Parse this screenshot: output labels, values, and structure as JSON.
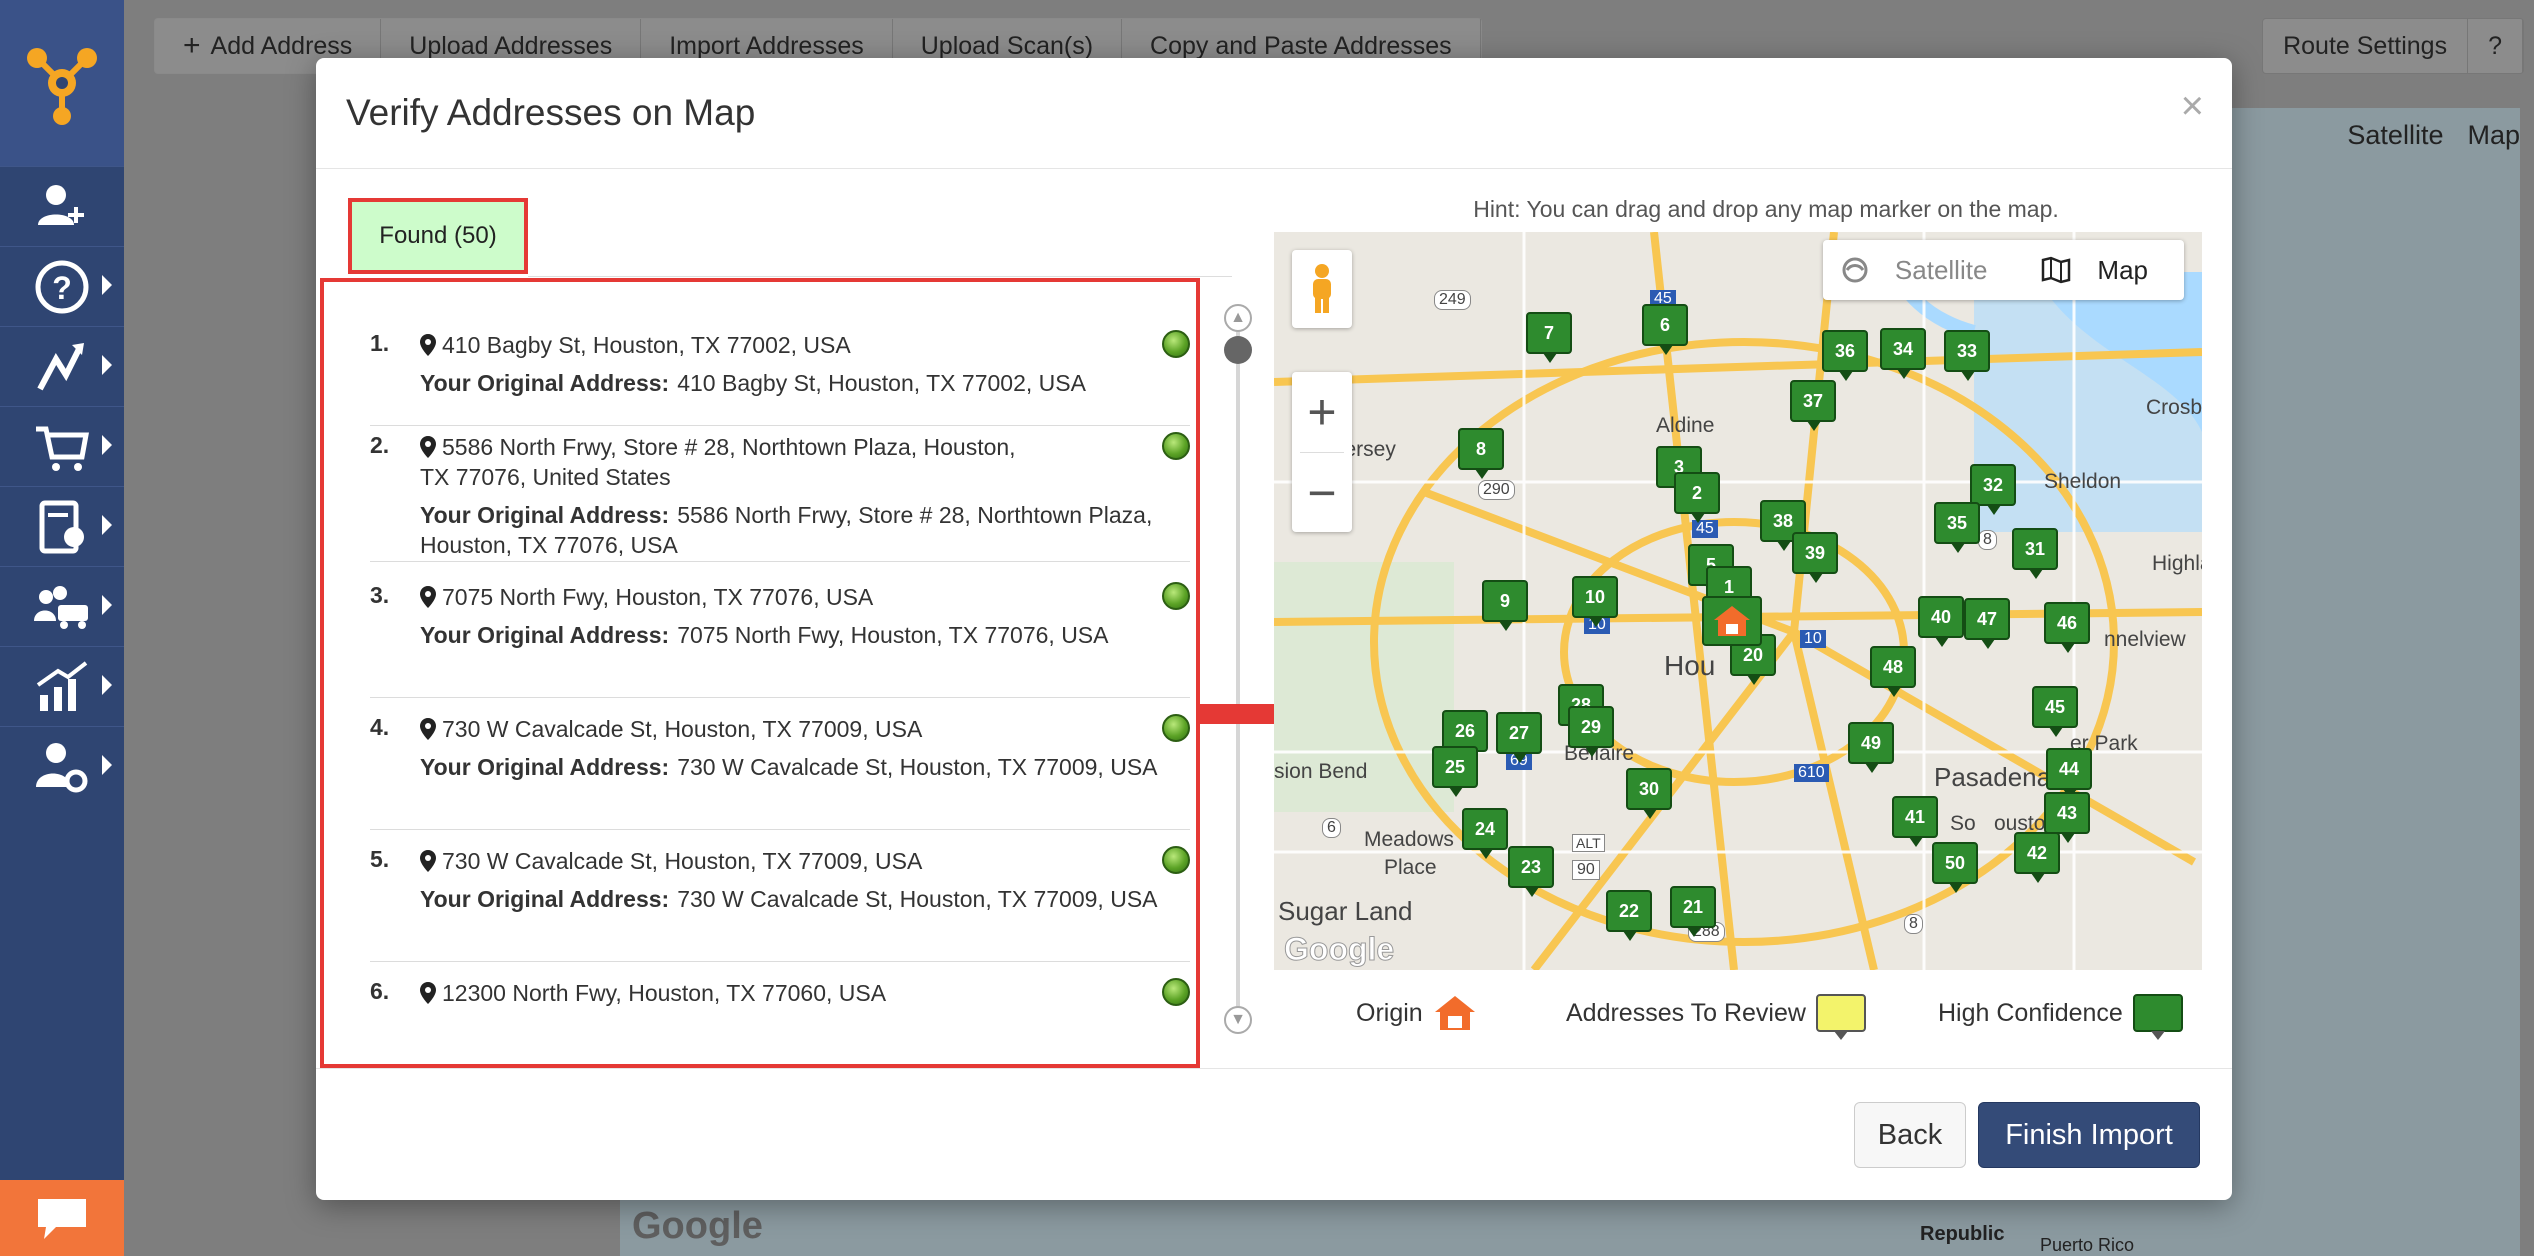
{
  "background": {
    "toolbar": [
      "Add Address",
      "Upload Addresses",
      "Import Addresses",
      "Upload Scan(s)",
      "Copy and Paste Addresses"
    ],
    "route_settings": "Route Settings",
    "help": "?",
    "map_toggle": {
      "satellite": "Satellite",
      "map": "Map"
    },
    "google": "Google",
    "map_labels": [
      "Republic",
      "Puerto Rico"
    ]
  },
  "modal": {
    "title": "Verify Addresses on Map",
    "close": "×",
    "tab_found": "Found (50)",
    "original_label": "Your Original Address:",
    "addresses": [
      {
        "num": "1.",
        "found": "410 Bagby St, Houston, TX 77002, USA",
        "original": "410 Bagby St, Houston, TX 77002, USA"
      },
      {
        "num": "2.",
        "found": "5586 North Frwy, Store # 28, Northtown Plaza, Houston, TX 77076, United States",
        "original": "5586 North Frwy, Store # 28, Northtown Plaza, Houston, TX 77076, USA"
      },
      {
        "num": "3.",
        "found": "7075 North Fwy, Houston, TX 77076, USA",
        "original": "7075 North Fwy, Houston, TX 77076, USA"
      },
      {
        "num": "4.",
        "found": "730 W Cavalcade St, Houston, TX 77009, USA",
        "original": "730 W Cavalcade St, Houston, TX 77009, USA"
      },
      {
        "num": "5.",
        "found": "730 W Cavalcade St, Houston, TX 77009, USA",
        "original": "730 W Cavalcade St, Houston, TX 77009, USA"
      },
      {
        "num": "6.",
        "found": "12300 North Fwy, Houston, TX 77060, USA",
        "original": ""
      }
    ],
    "hint": "Hint: You can drag and drop any map marker on the map.",
    "map": {
      "satellite": "Satellite",
      "map": "Map",
      "zoom_in": "+",
      "zoom_out": "−",
      "google": "Google",
      "labels": [
        "Jersey",
        "Aldine",
        "Sheldon",
        "Crosb",
        "Highla",
        "nnelview",
        "Hou",
        "Bellaire",
        "Pasadena",
        "er Park",
        "ouston",
        "So",
        "sion Bend",
        "Meadows",
        "Place",
        "Sugar Land"
      ],
      "roads": [
        "249",
        "45",
        "290",
        "8",
        "45",
        "10",
        "10",
        "69",
        "610",
        "6",
        "90",
        "ALT",
        "288",
        "8",
        "10"
      ],
      "markers": [
        "7",
        "6",
        "36",
        "34",
        "33",
        "37",
        "8",
        "3",
        "2",
        "32",
        "38",
        "35",
        "31",
        "39",
        "5",
        "1",
        "9",
        "10",
        "20",
        "40",
        "47",
        "46",
        "48",
        "28",
        "29",
        "26",
        "27",
        "45",
        "49",
        "25",
        "30",
        "44",
        "43",
        "41",
        "24",
        "42",
        "23",
        "50",
        "22",
        "21"
      ]
    },
    "legend": {
      "origin": "Origin",
      "review": "Addresses To Review",
      "high": "High Confidence"
    },
    "back": "Back",
    "finish": "Finish Import"
  }
}
